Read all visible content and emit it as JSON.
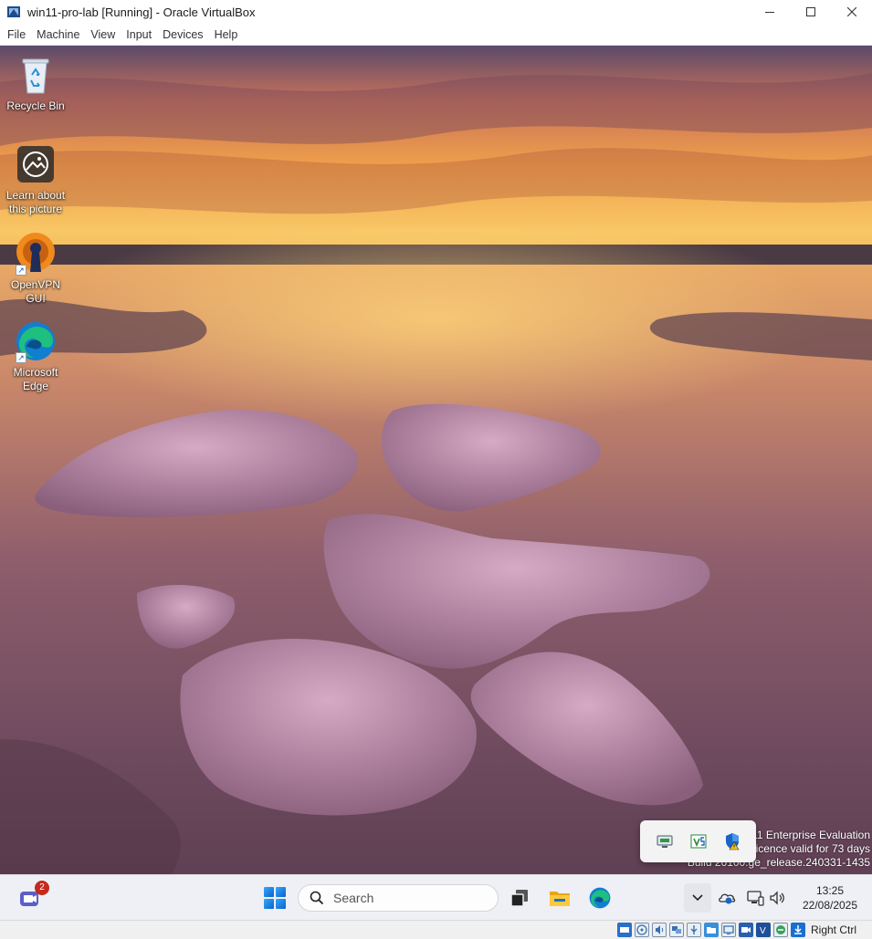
{
  "window": {
    "title": "win11-pro-lab [Running] - Oracle VirtualBox",
    "controls": [
      "minimize",
      "maximize",
      "close"
    ]
  },
  "menubar": {
    "items": [
      {
        "label": "File"
      },
      {
        "label": "Machine"
      },
      {
        "label": "View"
      },
      {
        "label": "Input"
      },
      {
        "label": "Devices"
      },
      {
        "label": "Help"
      }
    ]
  },
  "desktop": {
    "icons": [
      {
        "label": "Recycle Bin",
        "icon": "recycle-bin-icon"
      },
      {
        "label": "Learn about\nthis picture",
        "icon": "learn-picture-icon"
      },
      {
        "label": "OpenVPN GUI",
        "icon": "openvpn-icon"
      },
      {
        "label": "Microsoft\nEdge",
        "icon": "edge-icon"
      }
    ],
    "watermark": {
      "line1": "11 Enterprise Evaluation",
      "line2": "Licence valid for 73 days",
      "line3": "Build 26100.ge_release.240331-1435"
    }
  },
  "tray_flyout": {
    "icons": [
      "network-monitor-icon",
      "visual-studio-icon",
      "windows-security-warning-icon"
    ]
  },
  "taskbar": {
    "chat_badge": "2",
    "search_placeholder": "Search",
    "pinned": [
      "task-view-icon",
      "file-explorer-icon",
      "edge-icon"
    ],
    "tray": [
      "onedrive-icon",
      "network-icon",
      "volume-icon"
    ],
    "time": "13:25",
    "date": "22/08/2025"
  },
  "statusbar": {
    "host_key": "Right Ctrl",
    "icons": [
      "hard-disk-icon",
      "optical-drive-icon",
      "audio-icon",
      "network-adapter-icon",
      "usb-icon",
      "shared-folders-icon",
      "display-icon",
      "video-capture-icon",
      "cpu-icon",
      "mouse-integration-icon",
      "download-icon"
    ]
  },
  "colors": {
    "taskbar_bg": "#eef0f5",
    "accent": "#0a62d1",
    "badge": "#c42b1c"
  }
}
